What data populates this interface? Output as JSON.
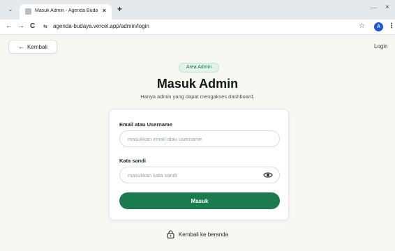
{
  "browser": {
    "tab_menu_icon": "chevron-down-icon",
    "tab_title": "Masuk Admin - Agenda Budaya",
    "tab_close": "×",
    "new_tab": "+",
    "window_minimize": "—",
    "window_close": "×",
    "back": "←",
    "forward": "→",
    "reload": "C",
    "site_info": "⇆",
    "url": "agenda-budaya.vercel.app/admin/login",
    "bookmark_star": "☆",
    "profile_initial": "A",
    "menu": "⋮"
  },
  "page": {
    "back_button_arrow": "←",
    "back_button_label": "Kembali",
    "login_link": "Login",
    "badge": "Area Admin",
    "title": "Masuk Admin",
    "subtitle": "Hanya admin yang dapat mengakses dashboard.",
    "form": {
      "email_label": "Email atau Username",
      "email_placeholder": "masukkan email atau username",
      "email_value": "",
      "password_label": "Kata sandi",
      "password_placeholder": "masukkan kata sandi",
      "password_value": "",
      "submit_label": "Masuk"
    },
    "home_link": "Kembali ke beranda"
  },
  "colors": {
    "accent": "#1b7a4e",
    "badge_bg": "#e4f3ea",
    "page_bg": "#f7f7f4"
  }
}
